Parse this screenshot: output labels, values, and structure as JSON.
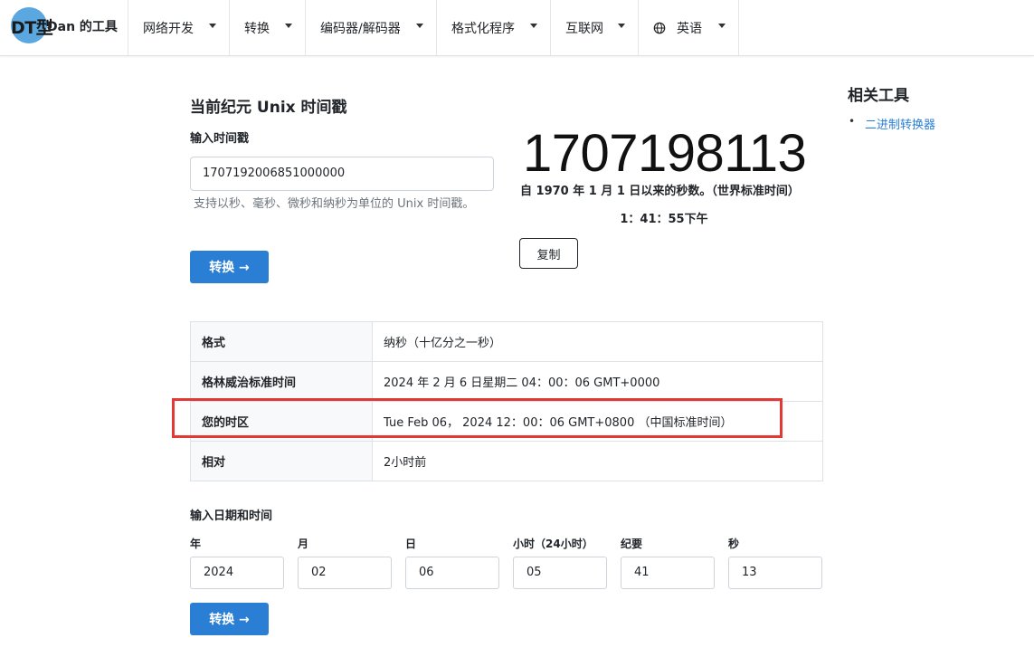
{
  "brand": {
    "logo_text": "DT型",
    "name": "Dan 的工具"
  },
  "nav": [
    {
      "label": "网络开发"
    },
    {
      "label": "转换"
    },
    {
      "label": "编码器/解码器"
    },
    {
      "label": "格式化程序"
    },
    {
      "label": "互联网"
    },
    {
      "label": "英语",
      "icon": "globe-icon"
    }
  ],
  "main": {
    "title": "当前纪元 Unix 时间戳",
    "input_label": "输入时间戳",
    "input_value": "1707192006851000000",
    "hint": "支持以秒、毫秒、微秒和纳秒为单位的 Unix 时间戳。",
    "convert_label": "转换 →",
    "current_timestamp": "1707198113",
    "since_text": "自 1970 年 1 月 1 日以来的秒数。（世界标准时间）",
    "clock": "1：41：55下午",
    "copy_label": "复制"
  },
  "sidebar": {
    "title": "相关工具",
    "bullet": "•",
    "links": [
      "二进制转换器"
    ]
  },
  "results": [
    {
      "key": "格式",
      "value": "纳秒（十亿分之一秒）"
    },
    {
      "key": "格林威治标准时间",
      "value": "2024 年 2 月 6 日星期二 04：00：06 GMT+0000"
    },
    {
      "key": "您的时区",
      "value": "Tue Feb 06， 2024 12：00：06 GMT+0800 （中国标准时间）"
    },
    {
      "key": "相对",
      "value": "2小时前"
    }
  ],
  "date_input": {
    "label": "输入日期和时间",
    "fields": [
      {
        "label": "年",
        "value": "2024"
      },
      {
        "label": "月",
        "value": "02"
      },
      {
        "label": "日",
        "value": "06"
      },
      {
        "label": "小时（24小时）",
        "value": "05"
      },
      {
        "label": "纪要",
        "value": "41"
      },
      {
        "label": "秒",
        "value": "13"
      }
    ],
    "convert_label": "转换 →"
  },
  "colors": {
    "accent": "#2a7fd4",
    "highlight": "#e23a33",
    "logo": "#5ba7e0"
  }
}
